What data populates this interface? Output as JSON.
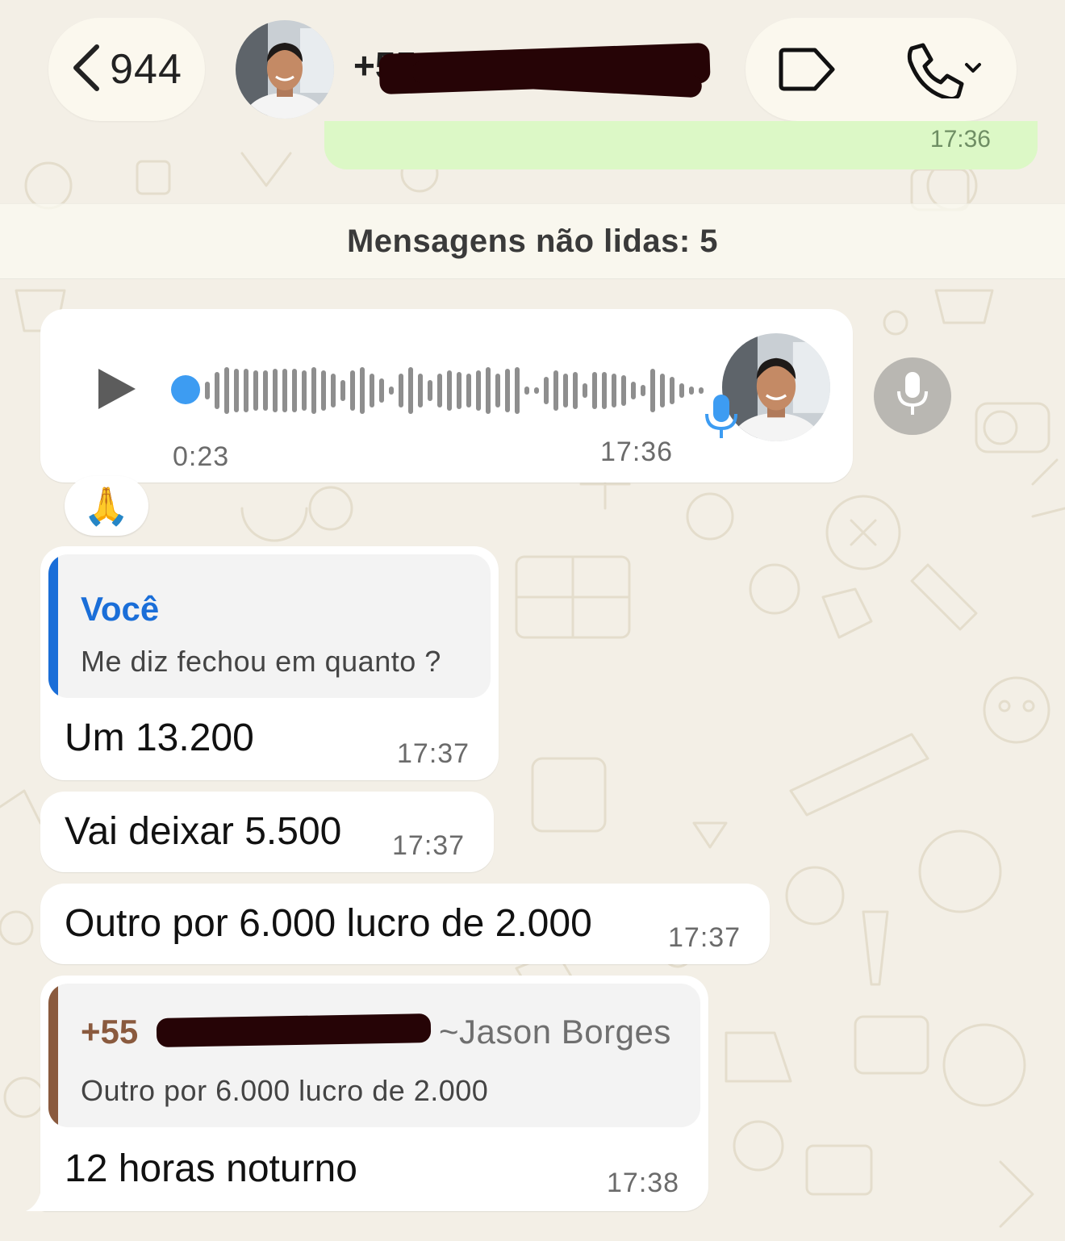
{
  "header": {
    "back_count": "944",
    "contact_phone": "+55",
    "icons": {
      "back": "chevron-left-icon",
      "label": "label-tag-icon",
      "call": "phone-icon",
      "call_menu": "chevron-down-icon"
    }
  },
  "previous_message": {
    "time": "17:36"
  },
  "unread_banner": "Mensagens não lidas: 5",
  "voice_note": {
    "duration": "0:23",
    "time": "17:36",
    "progress": 0,
    "icons": {
      "play": "play-icon",
      "mic_badge": "mic-icon"
    }
  },
  "reaction": "🙏",
  "messages": [
    {
      "quote": {
        "author": "Você",
        "text": "Me diz fechou em quanto ?",
        "color": "#1a6ed8"
      },
      "text": "Um 13.200",
      "time": "17:37"
    },
    {
      "text": "Vai deixar 5.500",
      "time": "17:37"
    },
    {
      "text": "Outro por 6.000 lucro de 2.000",
      "time": "17:37"
    },
    {
      "quote": {
        "author": "+55",
        "author_name": "~Jason Borges",
        "text": "Outro por 6.000 lucro de 2.000",
        "color": "#8a5a3e"
      },
      "text": "12 horas noturno",
      "time": "17:38"
    }
  ],
  "colors": {
    "background": "#f3efe6",
    "outgoing_bubble": "#dcf8c6",
    "incoming_bubble": "#ffffff",
    "voice_accent": "#3d9cf2",
    "redaction": "#260406"
  }
}
